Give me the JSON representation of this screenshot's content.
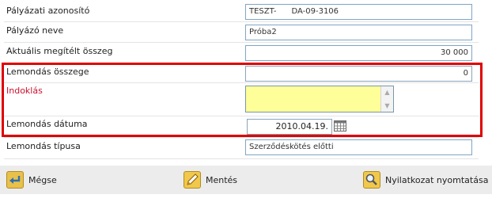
{
  "form": {
    "rows": [
      {
        "label": "Pályázati azonosító",
        "value": "TESZT-      DA-09-3106"
      },
      {
        "label": "Pályázó neve",
        "value": "Próba2"
      },
      {
        "label": "Aktuális megítélt összeg",
        "value": "30 000"
      },
      {
        "label": "Lemondás összege",
        "value": "0"
      },
      {
        "label": "Indoklás",
        "value": ""
      },
      {
        "label": "Lemondás dátuma",
        "value": "2010.04.19."
      },
      {
        "label": "Lemondás típusa",
        "value": "Szerződéskötés előtti"
      }
    ],
    "required_label_color": "#c8102e",
    "textarea_bg": "#ffff99",
    "highlight_color": "#e00000"
  },
  "toolbar": {
    "cancel_label": "Mégse",
    "save_label": "Mentés",
    "print_label": "Nyilatkozat nyomtatása"
  },
  "icons": {
    "cancel": "back-arrow-icon",
    "save": "pencil-icon",
    "print": "magnifier-icon",
    "date": "calendar-icon"
  }
}
